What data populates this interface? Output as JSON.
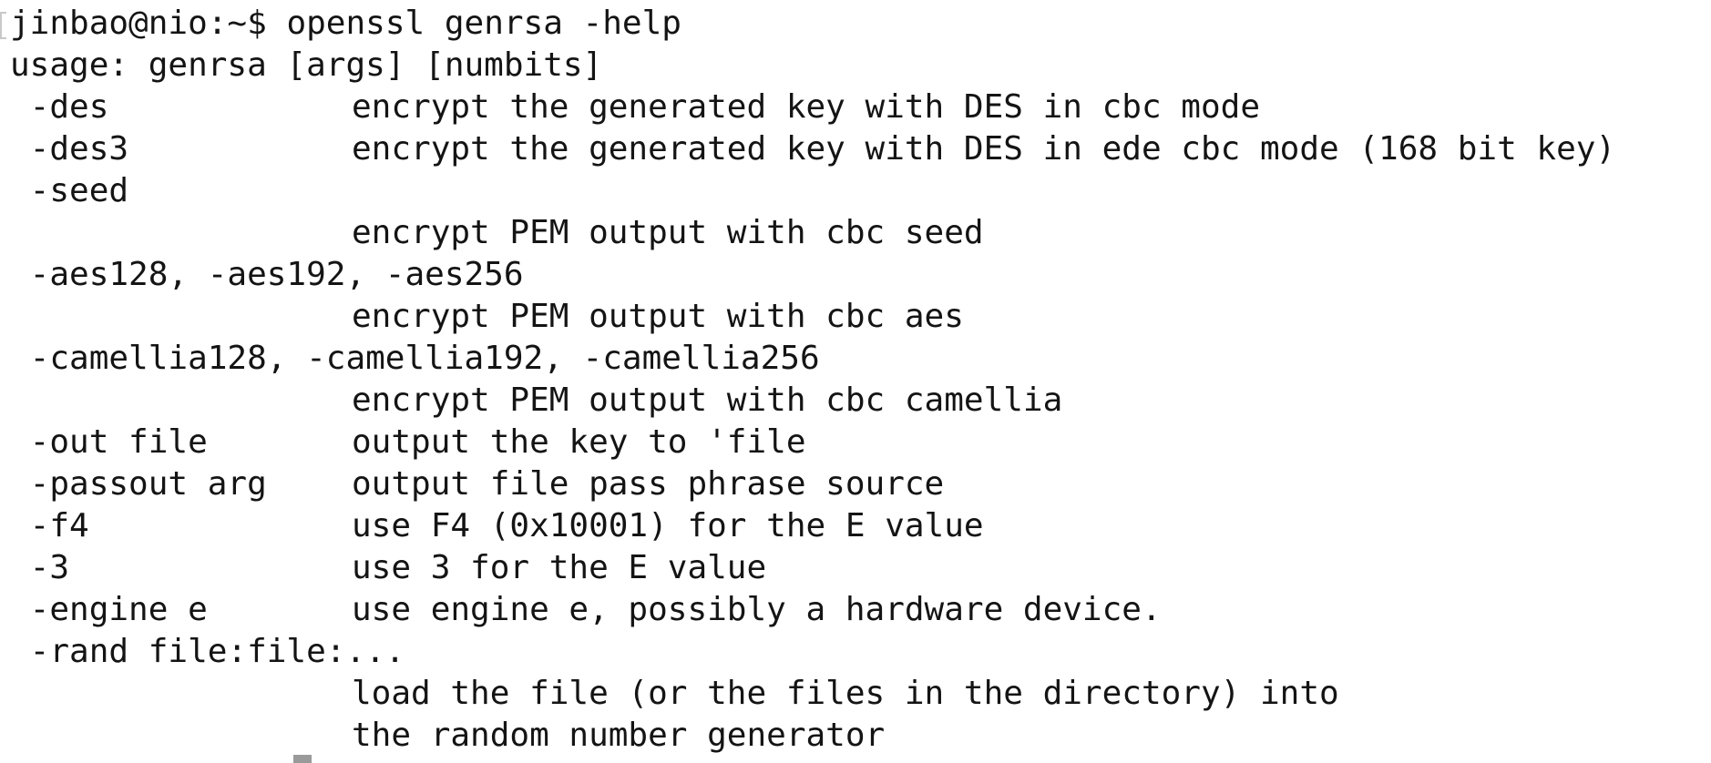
{
  "terminal": {
    "prompt": "jinbao@nio:~$",
    "command": "openssl genrsa -help",
    "usage": "usage: genrsa [args] [numbits]",
    "options": [
      {
        "flag": " -des",
        "desc": "encrypt the generated key with DES in cbc mode"
      },
      {
        "flag": " -des3",
        "desc": "encrypt the generated key with DES in ede cbc mode (168 bit key)"
      },
      {
        "flag": " -seed",
        "desc": ""
      },
      {
        "flag": "",
        "desc": "encrypt PEM output with cbc seed"
      },
      {
        "flag": " -aes128, -aes192, -aes256",
        "desc": ""
      },
      {
        "flag": "",
        "desc": "encrypt PEM output with cbc aes"
      },
      {
        "flag": " -camellia128, -camellia192, -camellia256",
        "desc": ""
      },
      {
        "flag": "",
        "desc": "encrypt PEM output with cbc camellia"
      },
      {
        "flag": " -out file",
        "desc": "output the key to 'file"
      },
      {
        "flag": " -passout arg",
        "desc": "output file pass phrase source"
      },
      {
        "flag": " -f4",
        "desc": "use F4 (0x10001) for the E value"
      },
      {
        "flag": " -3",
        "desc": "use 3 for the E value"
      },
      {
        "flag": " -engine e",
        "desc": "use engine e, possibly a hardware device."
      },
      {
        "flag": " -rand file:file:...",
        "desc": ""
      },
      {
        "flag": "",
        "desc": "load the file (or the files in the directory) into"
      },
      {
        "flag": "",
        "desc": "the random number generator"
      }
    ]
  }
}
